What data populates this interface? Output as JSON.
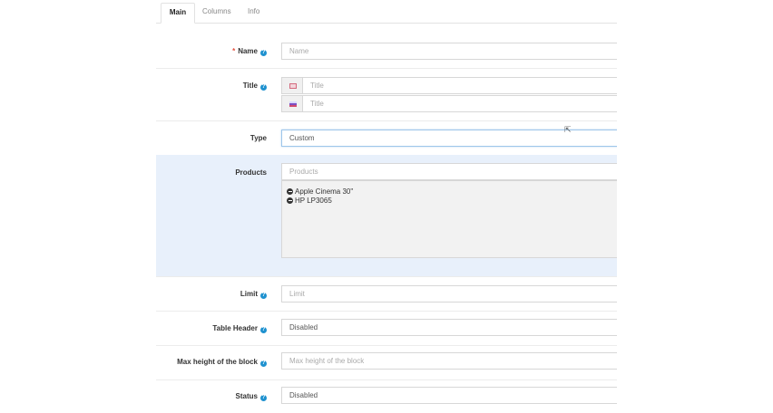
{
  "tabs": [
    {
      "label": "Main",
      "active": true
    },
    {
      "label": "Columns",
      "active": false
    },
    {
      "label": "Info",
      "active": false
    }
  ],
  "fields": {
    "name": {
      "label": "Name",
      "required_mark": "*",
      "placeholder": "Name"
    },
    "title": {
      "label": "Title",
      "languages": [
        {
          "flag": "flag-gb-icon",
          "placeholder": "Title"
        },
        {
          "flag": "flag-ru-icon",
          "placeholder": "Title"
        }
      ]
    },
    "type": {
      "label": "Type",
      "value": "Custom"
    },
    "products": {
      "label": "Products",
      "placeholder": "Products",
      "items": [
        "Apple Cinema 30\"",
        "HP LP3065"
      ]
    },
    "limit": {
      "label": "Limit",
      "placeholder": "Limit"
    },
    "table_header": {
      "label": "Table Header",
      "value": "Disabled"
    },
    "max_height": {
      "label": "Max height of the block",
      "placeholder": "Max height of the block"
    },
    "status": {
      "label": "Status",
      "value": "Disabled"
    }
  },
  "help_icon_glyph": "?",
  "colors": {
    "accent": "#1e91cf",
    "required": "#e3503e",
    "highlight_row": "#e8f0fb"
  }
}
